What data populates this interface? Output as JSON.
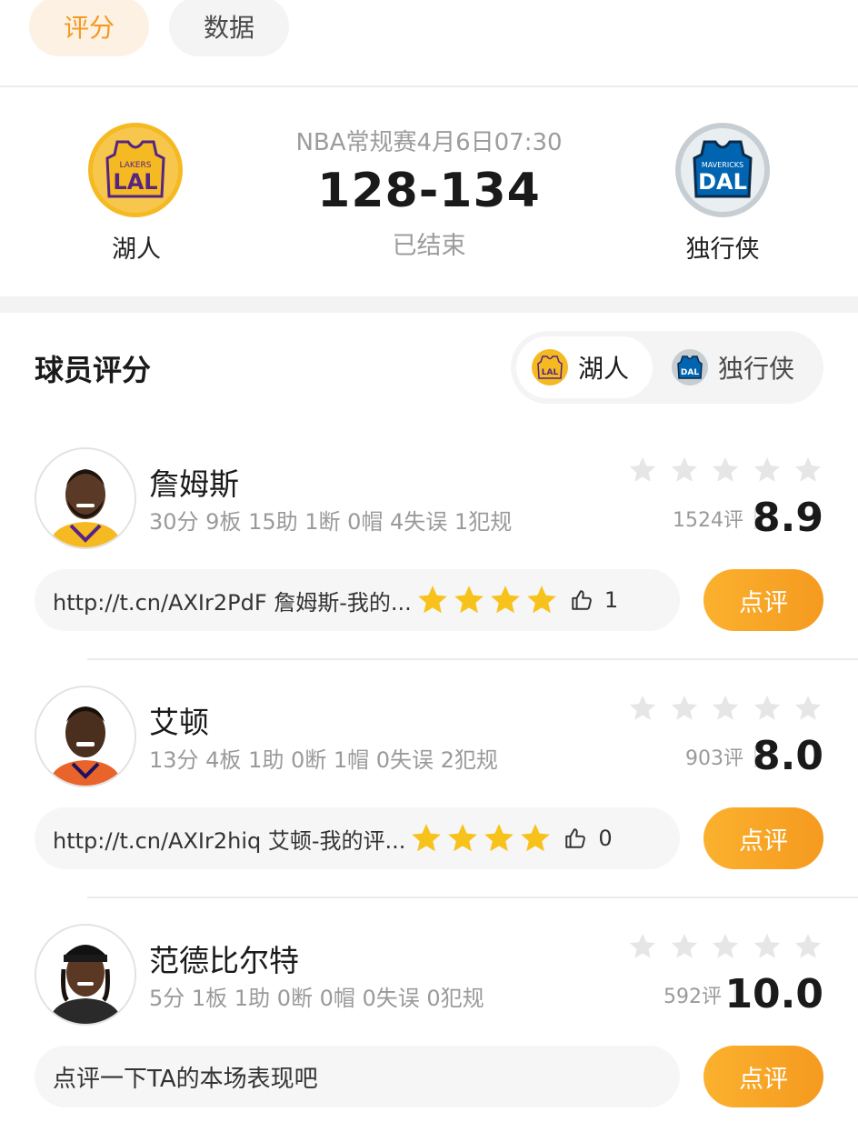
{
  "tabs": [
    {
      "label": "评分",
      "active": true
    },
    {
      "label": "数据",
      "active": false
    }
  ],
  "match": {
    "meta": "NBA常规赛4月6日07:30",
    "score": "128-134",
    "status": "已结束",
    "home": {
      "name": "湖人",
      "logo_text": "LAL",
      "logo_sub": "LAKERS",
      "colors": {
        "primary": "#f5b921",
        "secondary": "#552583"
      }
    },
    "away": {
      "name": "独行侠",
      "logo_text": "DAL",
      "logo_sub": "MAVERICKS",
      "colors": {
        "primary": "#0064b1",
        "secondary": "#bbc4ca"
      }
    }
  },
  "section": {
    "title": "球员评分",
    "switch": [
      {
        "label": "湖人",
        "active": true,
        "logo": "lakers-logo"
      },
      {
        "label": "独行侠",
        "active": false,
        "logo": "mavericks-logo"
      }
    ]
  },
  "players": [
    {
      "name": "詹姆斯",
      "stats": "30分 9板 15助 1断 0帽 4失误 1犯规",
      "review_count": "1524评",
      "rating": "8.9",
      "comment": "http://t.cn/AXIr2PdF 詹姆斯-我的...",
      "comment_stars": 4,
      "likes": "1",
      "button": "点评",
      "jersey_color": "#f5b921"
    },
    {
      "name": "艾顿",
      "stats": "13分 4板 1助 0断 1帽 0失误 2犯规",
      "review_count": "903评",
      "rating": "8.0",
      "comment": "http://t.cn/AXIr2hiq 艾顿-我的评...",
      "comment_stars": 4,
      "likes": "0",
      "button": "点评",
      "jersey_color": "#e8642a"
    },
    {
      "name": "范德比尔特",
      "stats": "5分 1板 1助 0断 0帽 0失误 0犯规",
      "review_count": "592评",
      "rating": "10.0",
      "placeholder": "点评一下TA的本场表现吧",
      "button": "点评",
      "jersey_color": "#2a2a2a"
    }
  ],
  "colors": {
    "accent": "#f39a22",
    "star_gold": "#f8c21c",
    "star_gray": "#e6e6e6"
  }
}
